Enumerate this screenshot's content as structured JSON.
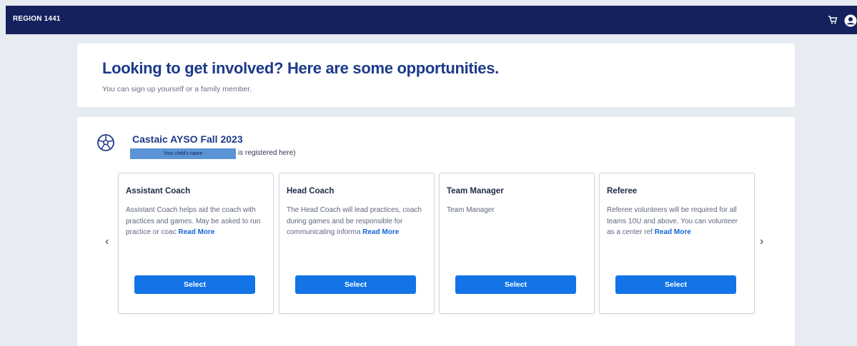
{
  "header": {
    "brand": "REGION 1441",
    "icons": [
      "cart-icon",
      "account-icon"
    ]
  },
  "hero": {
    "title": "Looking to get involved? Here are some opportunities.",
    "subtitle": "You can sign up yourself or a family member."
  },
  "program": {
    "icon": "soccer-ball-icon",
    "title": "Castaic AYSO Fall 2023",
    "redacted_label": "Your child's name",
    "registered_text": "is registered here)",
    "nav": {
      "prev": "‹",
      "next": "›"
    },
    "roles": [
      {
        "title": "Assistant Coach",
        "description": "Assistant Coach helps aid the coach with practices and games. May be asked to run practice or coac",
        "read_more": "Read More",
        "button": "Select"
      },
      {
        "title": "Head Coach",
        "description": "The Head Coach will lead practices, coach during games and be responsible for communicating informa",
        "read_more": "Read More",
        "button": "Select"
      },
      {
        "title": "Team Manager",
        "description": "Team Manager",
        "read_more": "",
        "button": "Select"
      },
      {
        "title": "Referee",
        "description": "Referee volunteers will be required for all teams 10U and above. You can volunteer as a center ref",
        "read_more": "Read More",
        "button": "Select"
      }
    ]
  },
  "colors": {
    "navbar": "#14215c",
    "accent": "#1274e6",
    "title": "#1d3a8a",
    "page_bg": "#e7ebf2"
  }
}
